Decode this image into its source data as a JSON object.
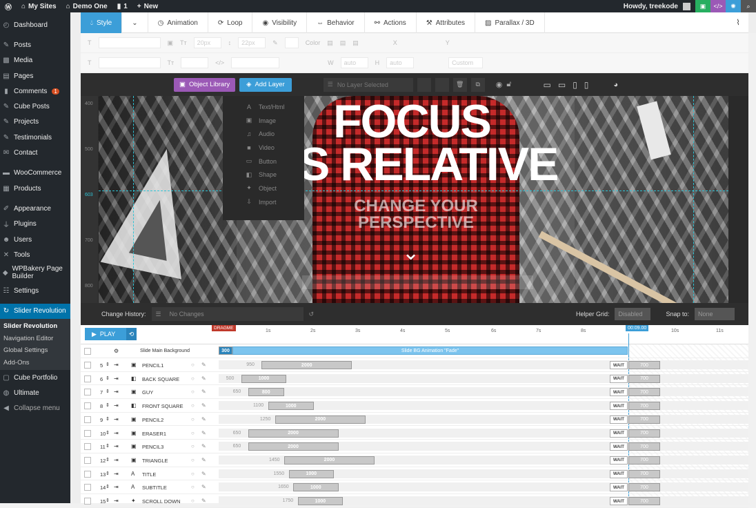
{
  "adminbar": {
    "my_sites": "My Sites",
    "site": "Demo One",
    "comments": "1",
    "new": "New",
    "howdy": "Howdy, treekode"
  },
  "sidebar": {
    "items": [
      {
        "label": "Dashboard",
        "icon": "dashboard-icon"
      },
      {
        "label": "Posts",
        "icon": "pin-icon"
      },
      {
        "label": "Media",
        "icon": "media-icon"
      },
      {
        "label": "Pages",
        "icon": "page-icon"
      },
      {
        "label": "Comments",
        "icon": "comment-icon",
        "badge": "1"
      },
      {
        "label": "Cube Posts",
        "icon": "pin-icon"
      },
      {
        "label": "Projects",
        "icon": "pin-icon"
      },
      {
        "label": "Testimonials",
        "icon": "pin-icon"
      },
      {
        "label": "Contact",
        "icon": "mail-icon"
      },
      {
        "label": "WooCommerce",
        "icon": "woo-icon"
      },
      {
        "label": "Products",
        "icon": "box-icon"
      },
      {
        "label": "Appearance",
        "icon": "brush-icon"
      },
      {
        "label": "Plugins",
        "icon": "plug-icon"
      },
      {
        "label": "Users",
        "icon": "user-icon"
      },
      {
        "label": "Tools",
        "icon": "wrench-icon"
      },
      {
        "label": "WPBakery Page Builder",
        "icon": "wpbakery-icon"
      },
      {
        "label": "Settings",
        "icon": "settings-icon"
      },
      {
        "label": "Slider Revolution",
        "icon": "refresh-icon"
      }
    ],
    "submenu": [
      "Slider Revolution",
      "Navigation Editor",
      "Global Settings",
      "Add-Ons"
    ],
    "after": [
      {
        "label": "Cube Portfolio",
        "icon": "cube-icon"
      },
      {
        "label": "Ultimate",
        "icon": "shield-icon"
      },
      {
        "label": "Collapse menu",
        "icon": "collapse-icon"
      }
    ]
  },
  "tabs": [
    "Style",
    "Animation",
    "Loop",
    "Visibility",
    "Behavior",
    "Actions",
    "Attributes",
    "Parallax / 3D"
  ],
  "props": {
    "font_size": "20px",
    "line_height": "22px",
    "color_label": "Color",
    "auto1": "auto",
    "auto2": "auto",
    "custom": "Custom"
  },
  "stage": {
    "object_library": "Object Library",
    "add_layer": "Add Layer",
    "no_layer": "No Layer Selected",
    "dropdown": [
      "Text/Html",
      "Image",
      "Audio",
      "Video",
      "Button",
      "Shape",
      "Object",
      "Import"
    ],
    "ruler": [
      "400",
      "500",
      "603",
      "700",
      "800"
    ],
    "slide": {
      "line1": "FOCUS",
      "line2": "S RELATIVE",
      "sub1": "CHANGE YOUR",
      "sub2": "PERSPECTIVE"
    },
    "change_history": "Change History:",
    "no_changes": "No Changes",
    "helper_grid": "Helper Grid:",
    "helper_value": "Disabled",
    "snap_to": "Snap to:",
    "snap_value": "None"
  },
  "timeline": {
    "play": "PLAY",
    "dragme": "DRAGME",
    "end_time": "00:09.00",
    "ticks": [
      "1s",
      "2s",
      "3s",
      "4s",
      "5s",
      "6s",
      "7s",
      "8s",
      "10s",
      "11s"
    ],
    "bg_label": "Slide Main Background",
    "bg_start": "300",
    "bg_anim": "Slide BG Animation \"Fade\"",
    "wait": "WAIT",
    "end_val": "700",
    "layers": [
      {
        "num": "5",
        "name": "PENCIL1",
        "type": "image",
        "start": "950",
        "dur": "2000"
      },
      {
        "num": "6",
        "name": "BACK SQUARE",
        "type": "shape",
        "start": "500",
        "dur": "1000"
      },
      {
        "num": "7",
        "name": "GUY",
        "type": "image",
        "start": "650",
        "dur": "800"
      },
      {
        "num": "8",
        "name": "FRONT SQUARE",
        "type": "shape",
        "start": "1100",
        "dur": "1000"
      },
      {
        "num": "9",
        "name": "PENCIL2",
        "type": "image",
        "start": "1250",
        "dur": "2000"
      },
      {
        "num": "10",
        "name": "ERASER1",
        "type": "image",
        "start": "650",
        "dur": "2000"
      },
      {
        "num": "11",
        "name": "PENCIL3",
        "type": "image",
        "start": "650",
        "dur": "2000"
      },
      {
        "num": "12",
        "name": "TRIANGLE",
        "type": "image",
        "start": "1450",
        "dur": "2000"
      },
      {
        "num": "13",
        "name": "TITLE",
        "type": "text",
        "start": "1550",
        "dur": "1000"
      },
      {
        "num": "14",
        "name": "SUBTITLE",
        "type": "text",
        "start": "1650",
        "dur": "1000"
      },
      {
        "num": "15",
        "name": "SCROLL DOWN",
        "type": "object",
        "start": "1750",
        "dur": "1000"
      }
    ]
  }
}
